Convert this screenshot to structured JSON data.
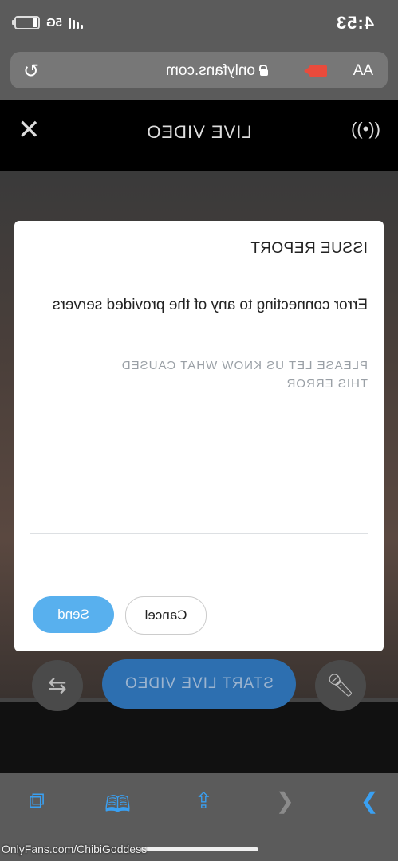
{
  "status_bar": {
    "time": "4:53",
    "network": "5G"
  },
  "browser": {
    "text_size_label": "AA",
    "url": "onlyfans.com"
  },
  "header": {
    "title": "LIVE VIDEO"
  },
  "issue_report": {
    "title": "ISSUE REPORT",
    "message": "Error connecting to any of the provided servers",
    "hint": "PLEASE LET US KNOW WHAT CAUSED THIS ERROR",
    "cancel_label": "Cancel",
    "send_label": "Send"
  },
  "controls": {
    "start_label": "START LIVE VIDEO"
  },
  "watermark": "OnlyFans.com/ChibiGoddess",
  "colors": {
    "accent": "#58b0ee",
    "start_button": "#2d6fb0",
    "recording": "#e94b3c"
  }
}
